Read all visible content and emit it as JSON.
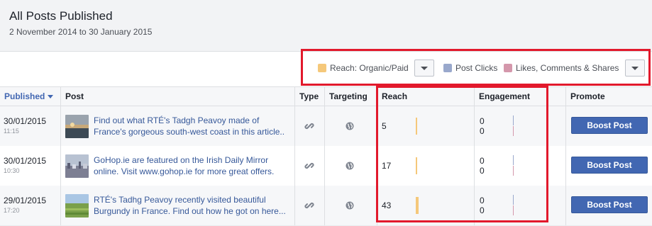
{
  "header": {
    "title": "All Posts Published",
    "date_range": "2 November 2014 to 30 January 2015"
  },
  "legend": {
    "reach_label": "Reach: Organic/Paid",
    "post_clicks_label": "Post Clicks",
    "likes_label": "Likes, Comments & Shares",
    "colors": {
      "reach": "#f5c87a",
      "post_clicks": "#99a8cc",
      "likes": "#d497ab"
    }
  },
  "columns": {
    "published": "Published",
    "post": "Post",
    "type": "Type",
    "targeting": "Targeting",
    "reach": "Reach",
    "engagement": "Engagement",
    "promote": "Promote"
  },
  "rows": [
    {
      "date": "30/01/2015",
      "time": "11:15",
      "text": "Find out what RTÉ's Tadgh Peavoy made of France's gorgeous south-west coast in this article..",
      "type_icon": "link-icon",
      "targeting_icon": "globe-icon",
      "reach": "5",
      "clicks": "0",
      "likes": "0",
      "boost_label": "Boost Post"
    },
    {
      "date": "30/01/2015",
      "time": "10:30",
      "text": "GoHop.ie are featured on the Irish Daily Mirror online. Visit www.gohop.ie for more great offers.",
      "type_icon": "link-icon",
      "targeting_icon": "globe-icon",
      "reach": "17",
      "clicks": "0",
      "likes": "0",
      "boost_label": "Boost Post"
    },
    {
      "date": "29/01/2015",
      "time": "17:20",
      "text": "RTÉ's Tadhg Peavoy recently visited beautiful Burgundy in France. Find out how he got on here...",
      "type_icon": "link-icon",
      "targeting_icon": "globe-icon",
      "reach": "43",
      "clicks": "0",
      "likes": "0",
      "boost_label": "Boost Post"
    }
  ]
}
